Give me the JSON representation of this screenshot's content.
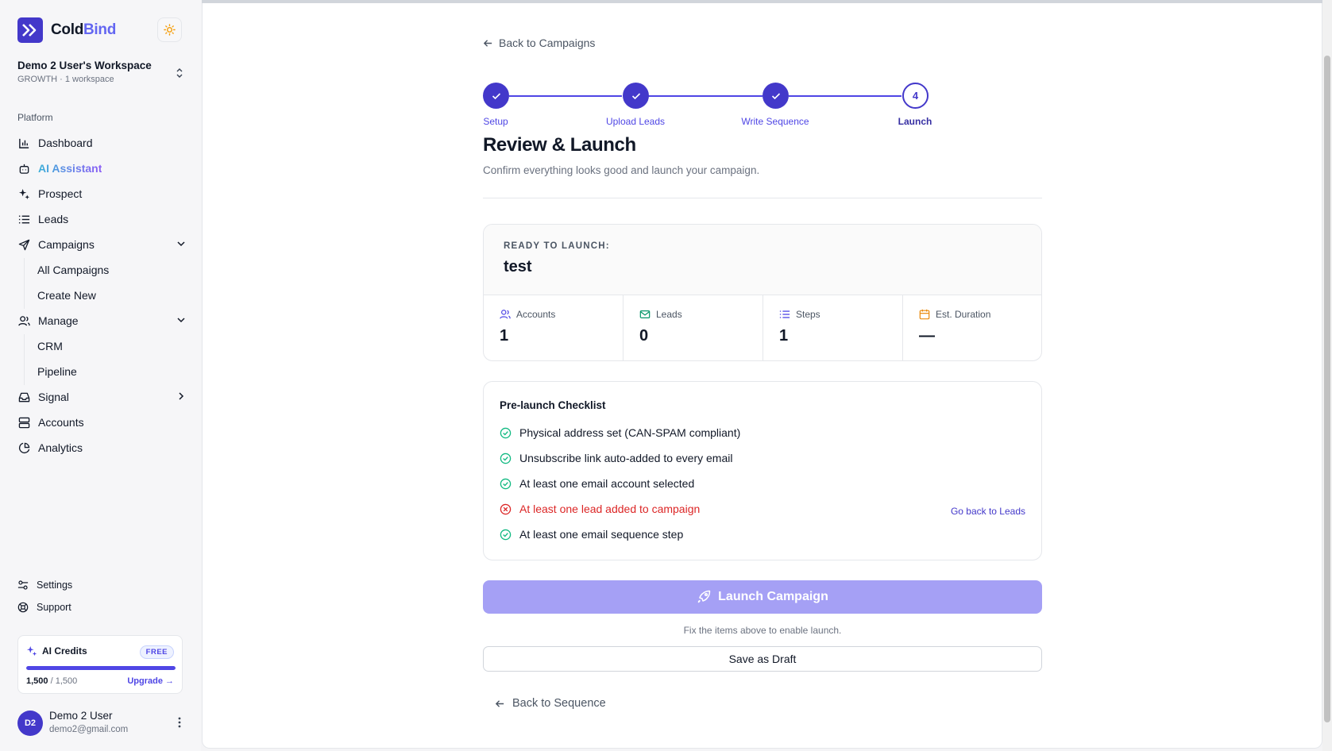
{
  "brand": {
    "name_part1": "Cold",
    "name_part2": "Bind",
    "accent": "#4338ca"
  },
  "workspace": {
    "name": "Demo 2 User's Workspace",
    "sub": "GROWTH · 1 workspace"
  },
  "sidebar": {
    "section_label": "Platform",
    "items": [
      {
        "label": "Dashboard",
        "icon": "bar-chart-icon"
      },
      {
        "label": "AI Assistant",
        "icon": "bot-icon"
      },
      {
        "label": "Prospect",
        "icon": "sparkles-icon"
      },
      {
        "label": "Leads",
        "icon": "list-icon"
      },
      {
        "label": "Campaigns",
        "icon": "send-icon"
      },
      {
        "label": "Manage",
        "icon": "users-icon"
      },
      {
        "label": "Signal",
        "icon": "inbox-icon"
      },
      {
        "label": "Accounts",
        "icon": "server-icon"
      },
      {
        "label": "Analytics",
        "icon": "pie-chart-icon"
      }
    ],
    "campaigns_sub": [
      "All Campaigns",
      "Create New"
    ],
    "manage_sub": [
      "CRM",
      "Pipeline"
    ],
    "settings_label": "Settings",
    "support_label": "Support"
  },
  "credits": {
    "title": "AI Credits",
    "badge": "FREE",
    "used": "1,500",
    "total": "/ 1,500",
    "fraction": 1.0,
    "upgrade_label": "Upgrade →"
  },
  "user": {
    "initials": "D2",
    "name": "Demo 2 User",
    "email": "demo2@gmail.com"
  },
  "main": {
    "back_top": "Back to Campaigns",
    "steps": [
      {
        "label": "Setup",
        "state": "done"
      },
      {
        "label": "Upload Leads",
        "state": "done"
      },
      {
        "label": "Write Sequence",
        "state": "done"
      },
      {
        "label": "Launch",
        "state": "current",
        "number": "4"
      }
    ],
    "title": "Review & Launch",
    "subtitle": "Confirm everything looks good and launch your campaign.",
    "summary": {
      "ready_label": "READY TO LAUNCH:",
      "campaign_name": "test",
      "stats": [
        {
          "label": "Accounts",
          "value": "1",
          "icon": "users-icon",
          "color": "#4f46e5"
        },
        {
          "label": "Leads",
          "value": "0",
          "icon": "mail-icon",
          "color": "#059669"
        },
        {
          "label": "Steps",
          "value": "1",
          "icon": "list-icon",
          "color": "#4f46e5"
        },
        {
          "label": "Est. Duration",
          "value": "—",
          "icon": "calendar-icon",
          "color": "#ea8a0c"
        }
      ]
    },
    "checklist": {
      "title": "Pre-launch Checklist",
      "items": [
        {
          "label": "Physical address set (CAN-SPAM compliant)",
          "ok": true
        },
        {
          "label": "Unsubscribe link auto-added to every email",
          "ok": true
        },
        {
          "label": "At least one email account selected",
          "ok": true
        },
        {
          "label": "At least one lead added to campaign",
          "ok": false
        },
        {
          "label": "At least one email sequence step",
          "ok": true
        }
      ],
      "go_back_label": "Go back to Leads"
    },
    "launch_label": "Launch Campaign",
    "hint": "Fix the items above to enable launch.",
    "draft_label": "Save as Draft",
    "back_bottom": "Back to Sequence"
  }
}
